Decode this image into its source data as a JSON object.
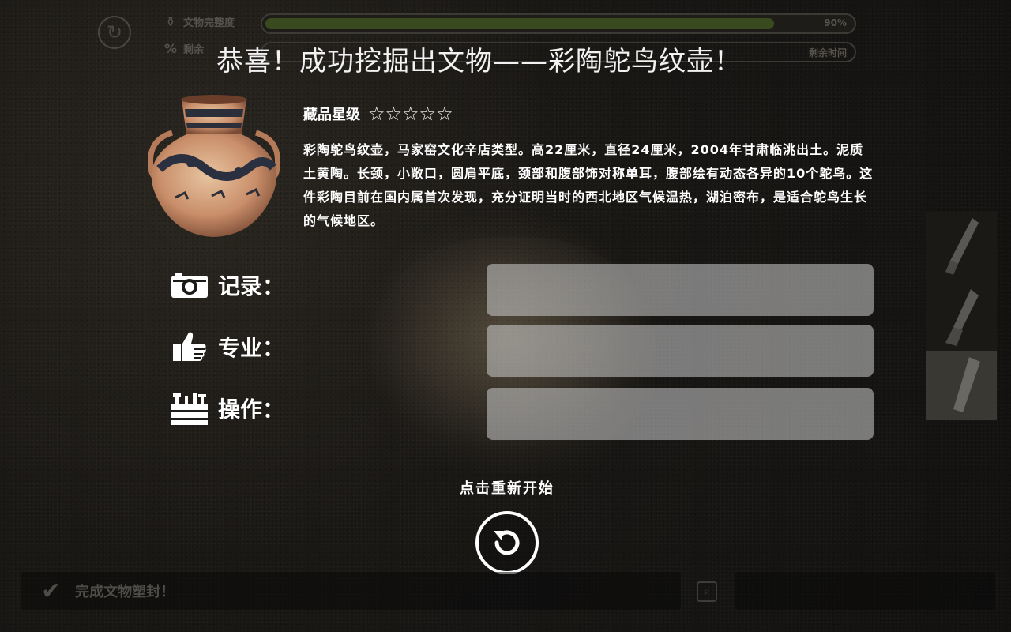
{
  "hud": {
    "integrity_label": "文物完整度",
    "integrity_value": "90%",
    "integrity_fraction": 0.9,
    "remaining_label": "剩余",
    "remaining_time_label": "剩余时间"
  },
  "result": {
    "title": "恭喜！成功挖掘出文物——彩陶鸵鸟纹壶！",
    "rating_label": "藏品星级",
    "stars": "☆☆☆☆☆",
    "description": "彩陶鸵鸟纹壶，马家窑文化辛店类型。高22厘米，直径24厘米，2004年甘肃临洮出土。泥质土黄陶。长颈，小敞口，圆肩平底，颈部和腹部饰对称单耳，腹部绘有动态各异的10个鸵鸟。这件彩陶目前在国内属首次发现，充分证明当时的西北地区气候温热，湖泊密布，是适合鸵鸟生长的气候地区。"
  },
  "evaluation": {
    "record_label": "记录：",
    "skill_label": "专业：",
    "operation_label": "操作："
  },
  "restart": {
    "label": "点击重新开始"
  },
  "bottom": {
    "task_text": "完成文物塑封！"
  },
  "icons": {
    "hud_refresh": "refresh-icon",
    "camera": "camera-icon",
    "thumbs_up": "thumbs-up-icon",
    "toolbox": "toolbox-icon",
    "restart": "restart-icon"
  },
  "colors": {
    "accent": "#ffffff",
    "progress_fill": "#3a4a1f",
    "panel": "#cdcdcd"
  }
}
